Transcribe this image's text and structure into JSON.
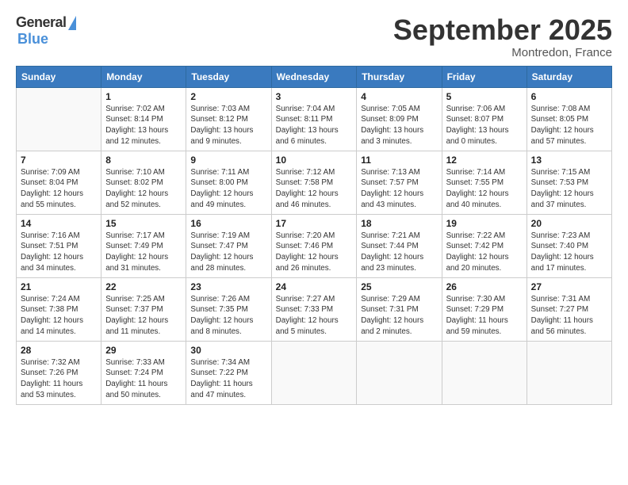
{
  "logo": {
    "general": "General",
    "blue": "Blue"
  },
  "title": {
    "month": "September 2025",
    "location": "Montredon, France"
  },
  "headers": [
    "Sunday",
    "Monday",
    "Tuesday",
    "Wednesday",
    "Thursday",
    "Friday",
    "Saturday"
  ],
  "weeks": [
    [
      {
        "day": "",
        "detail": ""
      },
      {
        "day": "1",
        "detail": "Sunrise: 7:02 AM\nSunset: 8:14 PM\nDaylight: 13 hours\nand 12 minutes."
      },
      {
        "day": "2",
        "detail": "Sunrise: 7:03 AM\nSunset: 8:12 PM\nDaylight: 13 hours\nand 9 minutes."
      },
      {
        "day": "3",
        "detail": "Sunrise: 7:04 AM\nSunset: 8:11 PM\nDaylight: 13 hours\nand 6 minutes."
      },
      {
        "day": "4",
        "detail": "Sunrise: 7:05 AM\nSunset: 8:09 PM\nDaylight: 13 hours\nand 3 minutes."
      },
      {
        "day": "5",
        "detail": "Sunrise: 7:06 AM\nSunset: 8:07 PM\nDaylight: 13 hours\nand 0 minutes."
      },
      {
        "day": "6",
        "detail": "Sunrise: 7:08 AM\nSunset: 8:05 PM\nDaylight: 12 hours\nand 57 minutes."
      }
    ],
    [
      {
        "day": "7",
        "detail": "Sunrise: 7:09 AM\nSunset: 8:04 PM\nDaylight: 12 hours\nand 55 minutes."
      },
      {
        "day": "8",
        "detail": "Sunrise: 7:10 AM\nSunset: 8:02 PM\nDaylight: 12 hours\nand 52 minutes."
      },
      {
        "day": "9",
        "detail": "Sunrise: 7:11 AM\nSunset: 8:00 PM\nDaylight: 12 hours\nand 49 minutes."
      },
      {
        "day": "10",
        "detail": "Sunrise: 7:12 AM\nSunset: 7:58 PM\nDaylight: 12 hours\nand 46 minutes."
      },
      {
        "day": "11",
        "detail": "Sunrise: 7:13 AM\nSunset: 7:57 PM\nDaylight: 12 hours\nand 43 minutes."
      },
      {
        "day": "12",
        "detail": "Sunrise: 7:14 AM\nSunset: 7:55 PM\nDaylight: 12 hours\nand 40 minutes."
      },
      {
        "day": "13",
        "detail": "Sunrise: 7:15 AM\nSunset: 7:53 PM\nDaylight: 12 hours\nand 37 minutes."
      }
    ],
    [
      {
        "day": "14",
        "detail": "Sunrise: 7:16 AM\nSunset: 7:51 PM\nDaylight: 12 hours\nand 34 minutes."
      },
      {
        "day": "15",
        "detail": "Sunrise: 7:17 AM\nSunset: 7:49 PM\nDaylight: 12 hours\nand 31 minutes."
      },
      {
        "day": "16",
        "detail": "Sunrise: 7:19 AM\nSunset: 7:47 PM\nDaylight: 12 hours\nand 28 minutes."
      },
      {
        "day": "17",
        "detail": "Sunrise: 7:20 AM\nSunset: 7:46 PM\nDaylight: 12 hours\nand 26 minutes."
      },
      {
        "day": "18",
        "detail": "Sunrise: 7:21 AM\nSunset: 7:44 PM\nDaylight: 12 hours\nand 23 minutes."
      },
      {
        "day": "19",
        "detail": "Sunrise: 7:22 AM\nSunset: 7:42 PM\nDaylight: 12 hours\nand 20 minutes."
      },
      {
        "day": "20",
        "detail": "Sunrise: 7:23 AM\nSunset: 7:40 PM\nDaylight: 12 hours\nand 17 minutes."
      }
    ],
    [
      {
        "day": "21",
        "detail": "Sunrise: 7:24 AM\nSunset: 7:38 PM\nDaylight: 12 hours\nand 14 minutes."
      },
      {
        "day": "22",
        "detail": "Sunrise: 7:25 AM\nSunset: 7:37 PM\nDaylight: 12 hours\nand 11 minutes."
      },
      {
        "day": "23",
        "detail": "Sunrise: 7:26 AM\nSunset: 7:35 PM\nDaylight: 12 hours\nand 8 minutes."
      },
      {
        "day": "24",
        "detail": "Sunrise: 7:27 AM\nSunset: 7:33 PM\nDaylight: 12 hours\nand 5 minutes."
      },
      {
        "day": "25",
        "detail": "Sunrise: 7:29 AM\nSunset: 7:31 PM\nDaylight: 12 hours\nand 2 minutes."
      },
      {
        "day": "26",
        "detail": "Sunrise: 7:30 AM\nSunset: 7:29 PM\nDaylight: 11 hours\nand 59 minutes."
      },
      {
        "day": "27",
        "detail": "Sunrise: 7:31 AM\nSunset: 7:27 PM\nDaylight: 11 hours\nand 56 minutes."
      }
    ],
    [
      {
        "day": "28",
        "detail": "Sunrise: 7:32 AM\nSunset: 7:26 PM\nDaylight: 11 hours\nand 53 minutes."
      },
      {
        "day": "29",
        "detail": "Sunrise: 7:33 AM\nSunset: 7:24 PM\nDaylight: 11 hours\nand 50 minutes."
      },
      {
        "day": "30",
        "detail": "Sunrise: 7:34 AM\nSunset: 7:22 PM\nDaylight: 11 hours\nand 47 minutes."
      },
      {
        "day": "",
        "detail": ""
      },
      {
        "day": "",
        "detail": ""
      },
      {
        "day": "",
        "detail": ""
      },
      {
        "day": "",
        "detail": ""
      }
    ]
  ]
}
